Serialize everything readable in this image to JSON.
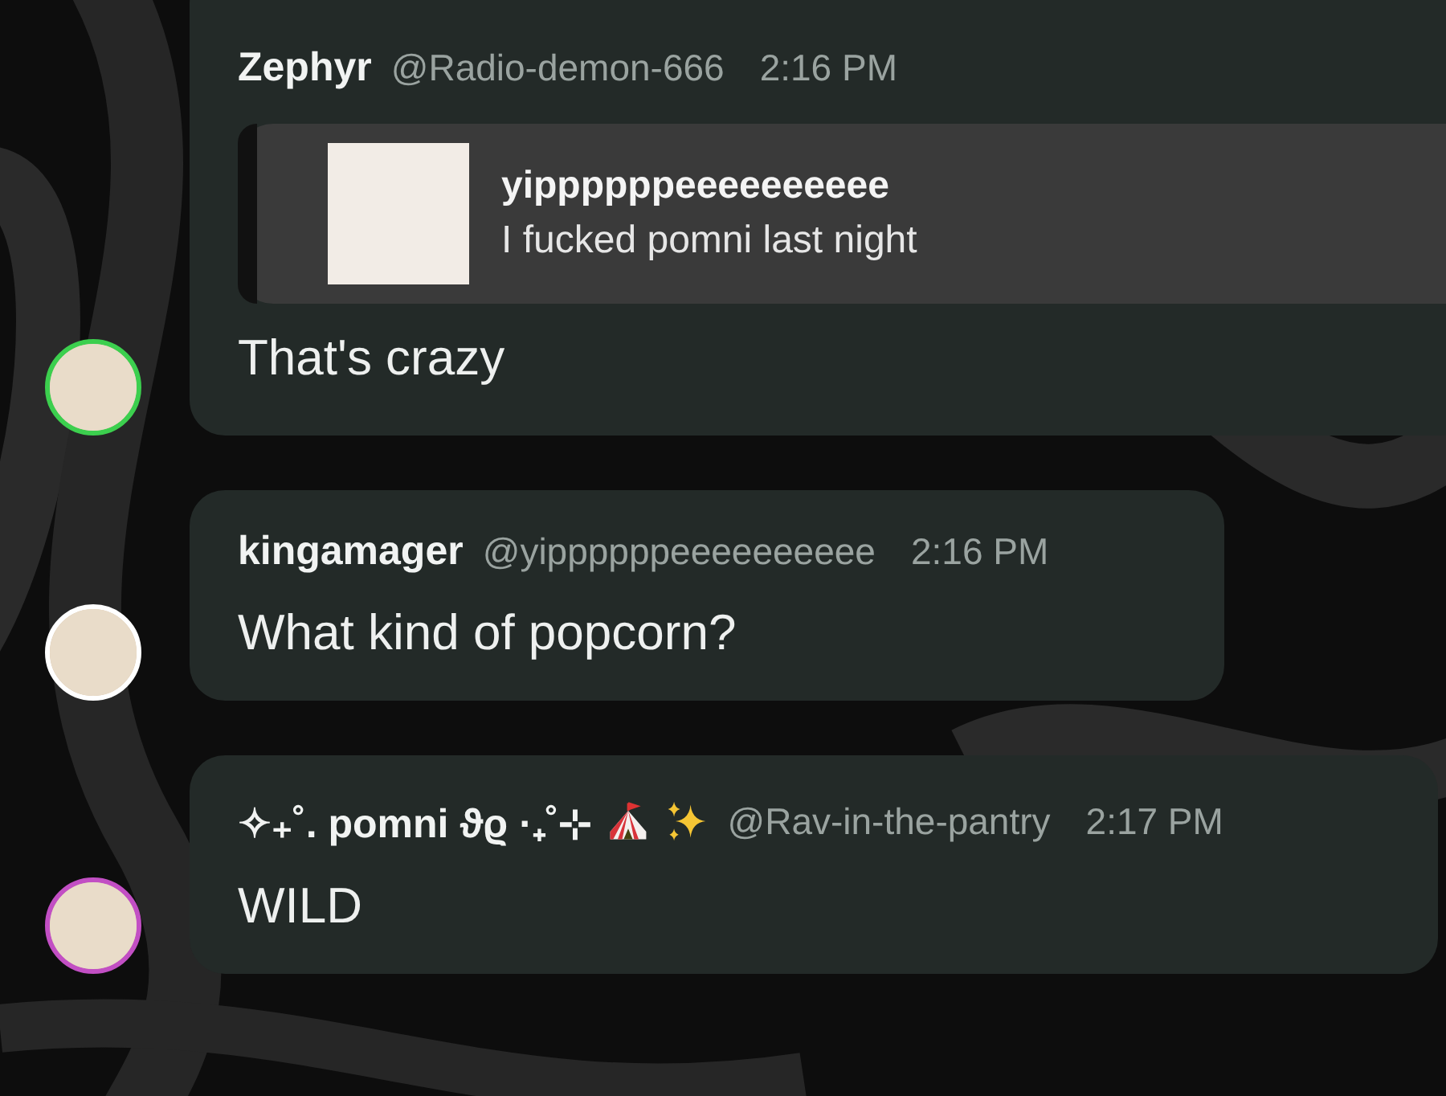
{
  "messages": [
    {
      "name": "Zephyr",
      "handle": "@Radio-demon-666",
      "time": "2:16 PM",
      "color": "#3ccf4e",
      "quote": {
        "author": "yippppppeeeeeeeeee",
        "text": "I fucked pomni last night"
      },
      "text": "That's crazy"
    },
    {
      "name": "kingamager",
      "handle": "@yippppppeeeeeeeeee",
      "time": "2:16 PM",
      "color": "#ffffff",
      "text": "What kind of popcorn?"
    },
    {
      "name": "✧₊˚. pomni ϑϱ ·₊˚⊹",
      "name_icons": [
        {
          "kind": "tent"
        },
        {
          "kind": "sparkles"
        }
      ],
      "handle": "@Rav-in-the-pantry",
      "time": "2:17 PM",
      "color": "#c24fc4",
      "text": "WILD"
    }
  ]
}
